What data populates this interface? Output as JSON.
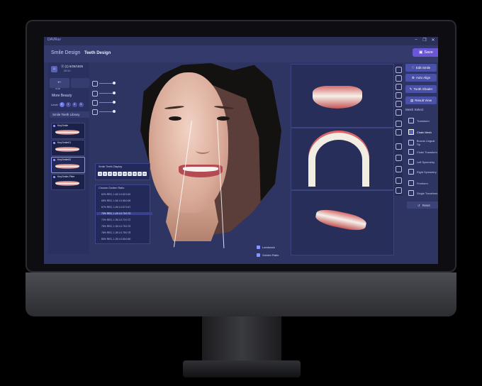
{
  "app": {
    "logo": "DAVRuv",
    "window_controls": [
      "–",
      "❐",
      "✕"
    ]
  },
  "header": {
    "module": "Smile Design",
    "tab": "Teeth Design",
    "save_label": "Save"
  },
  "patient": {
    "id": "ⓐ (1) 6/25/1925",
    "sub": "00/10",
    "avatar_icon": "person-icon"
  },
  "left": {
    "undo_label": "Undo",
    "more_beauty": "More Beauty",
    "level_label": "Level",
    "levels": [
      "0",
      "1",
      "2",
      "3"
    ],
    "library_title": "Smile Teeth Library",
    "library": [
      {
        "name": "KeySmile"
      },
      {
        "name": "KeySmile01"
      },
      {
        "name": "KeySmile02"
      },
      {
        "name": "KeySmile-Filter"
      }
    ]
  },
  "tooth_display": {
    "title": "Smile Teeth Display",
    "numbers": [
      "12",
      "11",
      "13",
      "21",
      "22",
      "23",
      "31",
      "32",
      "41",
      "42"
    ]
  },
  "golden_ratio": {
    "title": "Choose Golden Ratio",
    "options": [
      "62% RED, 1.62:1:0.62:0.62",
      "65% RED, 1.54:1:0.65:0.65",
      "67% RED, 1.49:1:0.67:0.67",
      "70% RED, 1.43:1:0.70:0.70",
      "72% RED, 1.39:1:0.72:0.72",
      "75% RED, 1.33:1:0.75:0.75",
      "78% RED, 1.28:1:0.78:0.78",
      "80% RED, 1.25:1:0.80:0.80"
    ],
    "selected_index": 3
  },
  "overlay_toggles": [
    "Landmark",
    "Golden Ratio"
  ],
  "right_buttons": [
    "Edit Smile",
    "Auto Align",
    "Tooth Shader",
    "Result View"
  ],
  "mesh": {
    "title": "Mesh Select",
    "items": [
      "Transform",
      "Chain Mesh",
      "Buccal-Lingual Tip",
      "Chain Transform",
      "Left Symmetry",
      "Right Symmetry",
      "Freeform",
      "Single Transform"
    ],
    "selected_index": 1,
    "reset_label": "Reset"
  },
  "colors": {
    "accent": "#6a57d8",
    "panel": "#2e3563",
    "button": "#4a51a8"
  }
}
